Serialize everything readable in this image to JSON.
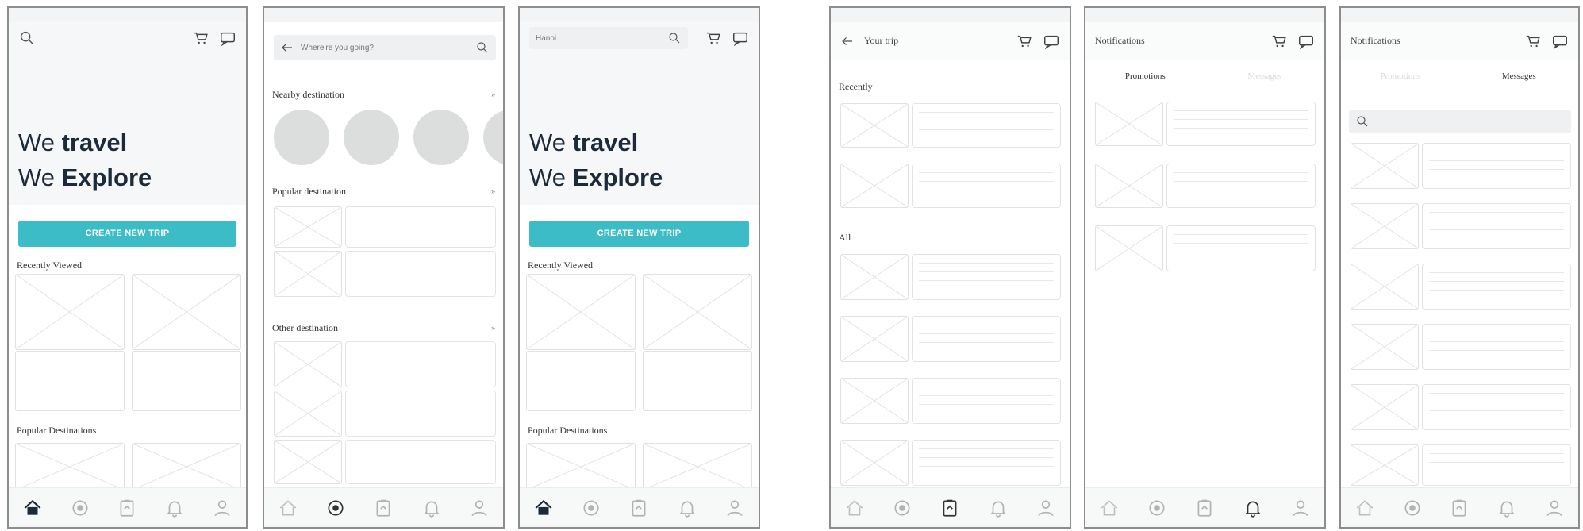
{
  "screens": [
    {
      "name": "home",
      "hero_line1_pre": "We ",
      "hero_line1_bold": "travel",
      "hero_line2_pre": "We ",
      "hero_line2_bold": "Explore",
      "cta_label": "CREATE NEW TRIP",
      "recently_viewed": "Recently Viewed",
      "popular_destinations": "Popular Destinations"
    },
    {
      "name": "search",
      "search_placeholder": "Where're you going?",
      "nearby": "Nearby destination",
      "popular": "Popular destination",
      "other": "Other destination",
      "more_label": "»"
    },
    {
      "name": "home-search",
      "search_value": "Hanoi",
      "hero_line1_pre": "We ",
      "hero_line1_bold": "travel",
      "hero_line2_pre": "We ",
      "hero_line2_bold": "Explore",
      "cta_label": "CREATE NEW TRIP",
      "recently_viewed": "Recently Viewed",
      "popular_destinations": "Popular Destinations"
    },
    {
      "name": "your-trip",
      "title": "Your trip",
      "recently": "Recently",
      "all": "All"
    },
    {
      "name": "notifications-promotions",
      "title": "Notifications",
      "tab_promotions": "Promotions",
      "tab_messages": "Messages"
    },
    {
      "name": "notifications-messages",
      "title": "Notifications",
      "tab_promotions": "Promotions",
      "tab_messages": "Messages"
    }
  ],
  "colors": {
    "accent": "#3bbcc7",
    "hero_text": "#1c2a3a",
    "placeholder_line": "#e1e1e1"
  },
  "icons": [
    "search-icon",
    "cart-icon",
    "chat-icon",
    "back-arrow-icon",
    "home-icon",
    "explore-icon",
    "trip-icon",
    "bell-icon",
    "profile-icon"
  ]
}
